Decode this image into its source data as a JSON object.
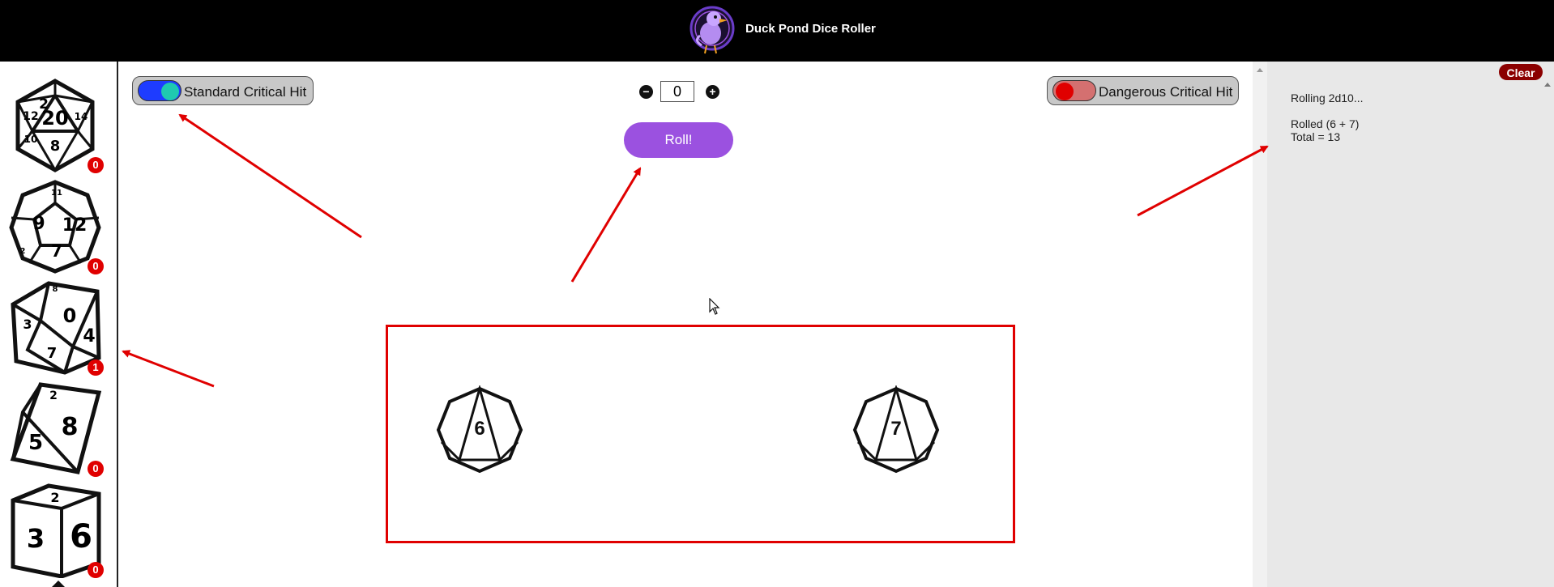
{
  "header": {
    "title": "Duck Pond Dice Roller"
  },
  "sidebar": {
    "dice": [
      {
        "name": "d20",
        "count": "0",
        "faces": [
          "2",
          "20",
          "8",
          "12",
          "10",
          "14",
          "18"
        ]
      },
      {
        "name": "d12",
        "count": "0",
        "faces": [
          "9",
          "12",
          "7",
          "11",
          "2"
        ]
      },
      {
        "name": "d10",
        "count": "1",
        "faces": [
          "0",
          "4",
          "3",
          "7",
          "8"
        ]
      },
      {
        "name": "d8",
        "count": "0",
        "faces": [
          "8",
          "5",
          "2"
        ]
      },
      {
        "name": "d6",
        "count": "0",
        "faces": [
          "2",
          "3",
          "6"
        ]
      }
    ]
  },
  "toggles": {
    "standard": {
      "label": "Standard Critical Hit",
      "state": "on"
    },
    "dangerous": {
      "label": "Dangerous Critical Hit",
      "state": "off"
    }
  },
  "modifier": {
    "value": "0",
    "decrement": "−",
    "increment": "+"
  },
  "roll_button": {
    "label": "Roll!"
  },
  "results": {
    "dice": [
      {
        "value": "6"
      },
      {
        "value": "7"
      }
    ]
  },
  "log": {
    "clear_label": "Clear",
    "rolling": "Rolling 2d10...",
    "rolled": "Rolled (6 + 7)",
    "total": "Total = 13"
  },
  "colors": {
    "accent": "#9b51e0",
    "badge": "#e00000",
    "header": "#000000",
    "toggle_on": "#1fc9b0",
    "toggle_off": "#e00000",
    "clear": "#8b0000"
  }
}
